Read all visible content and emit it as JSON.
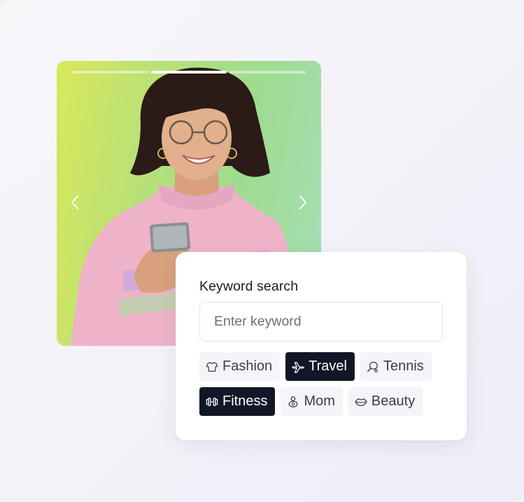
{
  "story": {
    "segments": [
      {
        "progress": 1.0
      },
      {
        "progress": 1.0
      },
      {
        "progress": 0.0
      }
    ],
    "prev_icon": "chevron-left-icon",
    "next_icon": "chevron-right-icon"
  },
  "search": {
    "title": "Keyword search",
    "placeholder": "Enter keyword",
    "value": ""
  },
  "tags": [
    {
      "label": "Fashion",
      "icon": "tshirt-icon",
      "active": false
    },
    {
      "label": "Travel",
      "icon": "airplane-icon",
      "active": true
    },
    {
      "label": "Tennis",
      "icon": "tennis-racket-icon",
      "active": false
    },
    {
      "label": "Fitness",
      "icon": "dumbbell-icon",
      "active": true
    },
    {
      "label": "Mom",
      "icon": "baby-icon",
      "active": false
    },
    {
      "label": "Beauty",
      "icon": "lips-icon",
      "active": false
    }
  ],
  "colors": {
    "active_tag_bg": "#121727",
    "inactive_tag_bg": "#f4f5f8",
    "title_text": "#171a2e",
    "photo_bg_left": "#d9e85a",
    "photo_bg_right": "#a6ddb7"
  }
}
